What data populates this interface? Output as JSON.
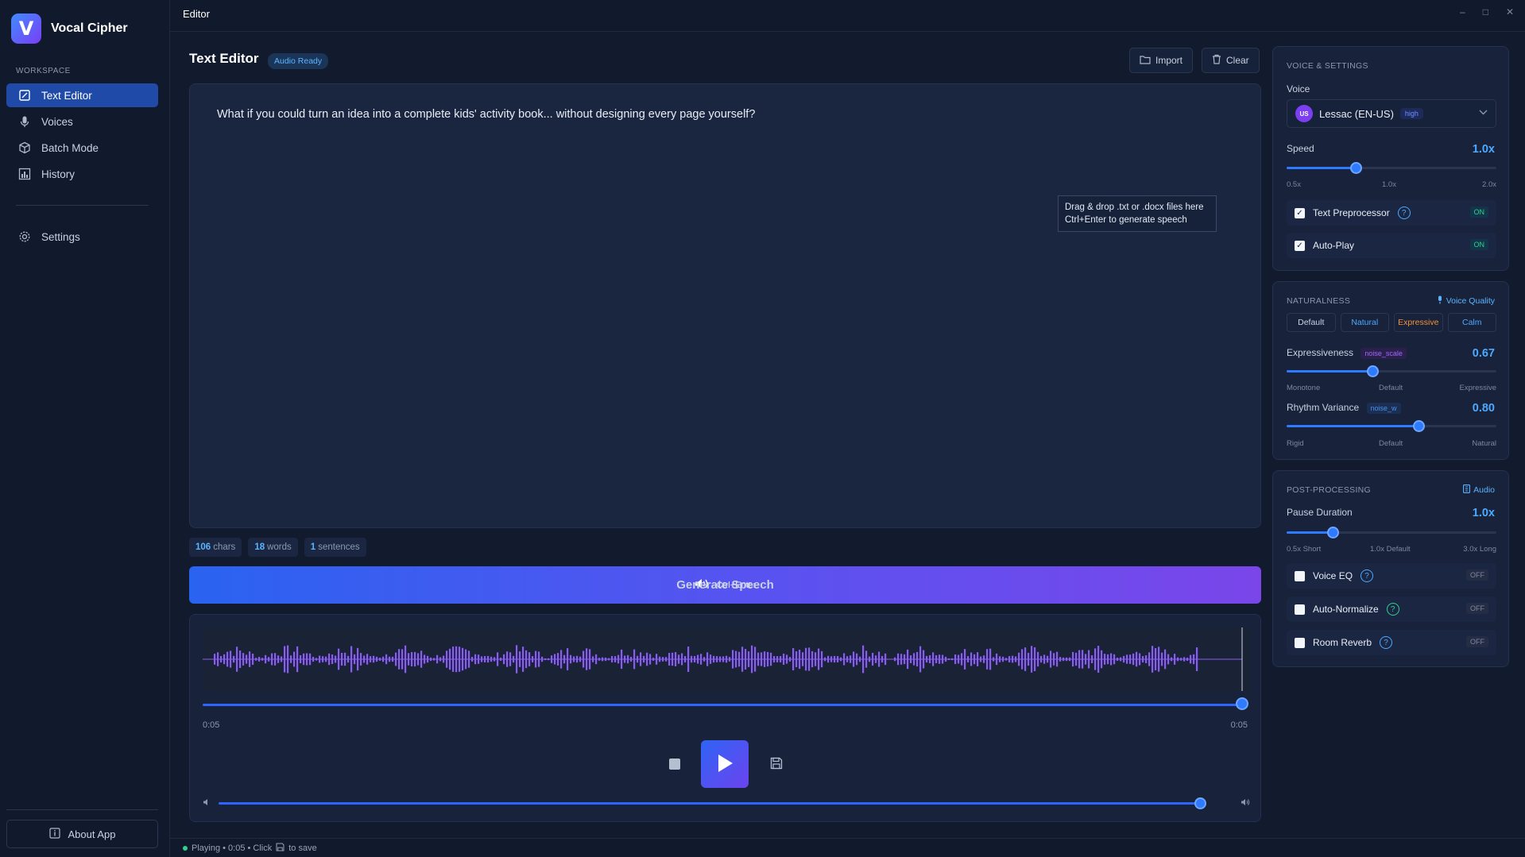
{
  "app": {
    "name": "Vocal Cipher",
    "logo_letter": "V"
  },
  "titlebar": {
    "title": "Editor",
    "minimize": "–",
    "maximize": "□",
    "close": "✕"
  },
  "sidebar": {
    "section_label": "WORKSPACE",
    "items": [
      {
        "label": "Text Editor",
        "icon": "text-editor-icon",
        "active": true
      },
      {
        "label": "Voices",
        "icon": "microphone-icon"
      },
      {
        "label": "Batch Mode",
        "icon": "cube-icon"
      },
      {
        "label": "History",
        "icon": "bar-chart-icon"
      }
    ],
    "settings": {
      "label": "Settings",
      "icon": "gear-icon"
    },
    "about": {
      "label": "About App",
      "icon": "info-icon"
    }
  },
  "editor": {
    "title": "Text Editor",
    "status_badge": "Audio Ready",
    "import_label": "Import",
    "clear_label": "Clear",
    "text": "What if you could turn an idea into a complete kids' activity book... without designing every page yourself?",
    "drop_tip_line1": "Drag & drop .txt or .docx files here",
    "drop_tip_line2": "Ctrl+Enter to generate speech"
  },
  "stats": {
    "chars_value": "106",
    "chars_label": "chars",
    "words_value": "18",
    "words_label": "words",
    "sentences_value": "1",
    "sentences_label": "sentences"
  },
  "generate": {
    "label": "Generate Speech",
    "shortcut": "Ctrl+Enter"
  },
  "player": {
    "time_current": "0:05",
    "time_total": "0:05",
    "progress": 1.0,
    "volume": 1.0
  },
  "status": {
    "text_before": "Playing • 0:05 • Click",
    "text_after": "to save"
  },
  "voice_settings": {
    "header": "VOICE & SETTINGS",
    "voice_label": "Voice",
    "voice_badge": "US",
    "voice_name": "Lessac (EN-US)",
    "voice_quality": "high",
    "speed_label": "Speed",
    "speed_value": "1.0x",
    "speed_fraction": 0.33,
    "speed_ticks": [
      "0.5x",
      "1.0x",
      "2.0x"
    ],
    "text_preprocessor": {
      "label": "Text Preprocessor",
      "state": "ON"
    },
    "auto_play": {
      "label": "Auto-Play",
      "state": "ON"
    }
  },
  "naturalness": {
    "header": "NATURALNESS",
    "link": "Voice Quality",
    "presets": [
      "Default",
      "Natural",
      "Expressive",
      "Calm"
    ],
    "preset_colors": [
      "#c9d2e2",
      "#4da9ff",
      "#f0913a",
      "#4da9ff"
    ],
    "expressiveness": {
      "label": "Expressiveness",
      "tag": "noise_scale",
      "value": "0.67",
      "fraction": 0.41,
      "ticks": [
        "Monotone",
        "Default",
        "Expressive"
      ]
    },
    "rhythm": {
      "label": "Rhythm Variance",
      "tag": "noise_w",
      "value": "0.80",
      "fraction": 0.63,
      "ticks": [
        "Rigid",
        "Default",
        "Natural"
      ]
    }
  },
  "post_processing": {
    "header": "POST-PROCESSING",
    "link": "Audio",
    "pause_label": "Pause Duration",
    "pause_value": "1.0x",
    "pause_fraction": 0.22,
    "pause_ticks": [
      "0.5x Short",
      "1.0x Default",
      "3.0x Long"
    ],
    "voice_eq": {
      "label": "Voice EQ",
      "state": "OFF"
    },
    "auto_normalize": {
      "label": "Auto-Normalize",
      "state": "OFF"
    },
    "room_reverb": {
      "label": "Room Reverb",
      "state": "OFF"
    }
  },
  "colors": {
    "accent": "#2f7bff",
    "wave": "#8a5cf6",
    "on": "#2fd28c"
  }
}
